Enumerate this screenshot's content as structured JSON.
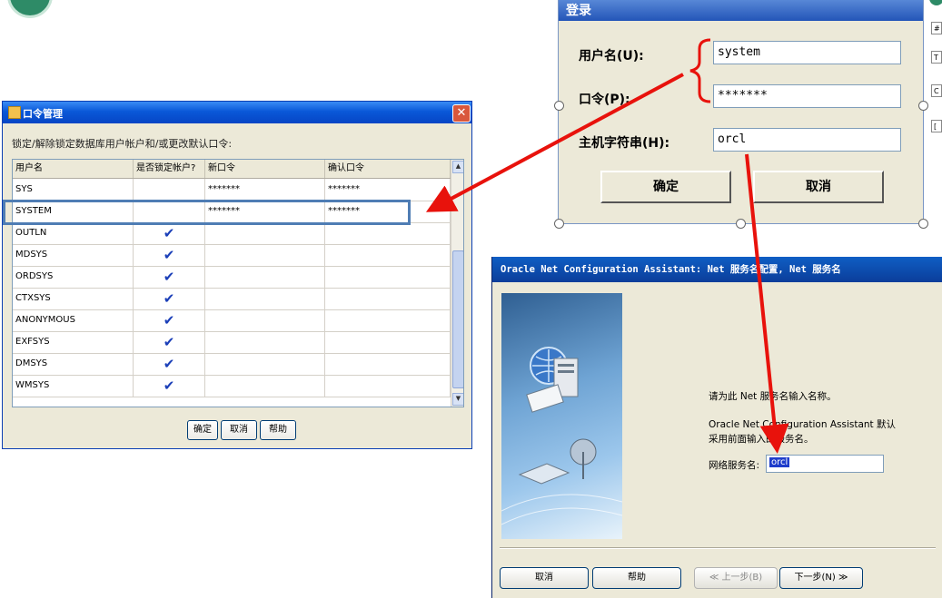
{
  "password_dialog": {
    "title": "口令管理",
    "close_glyph": "✕",
    "instruction": "锁定/解除锁定数据库用户帐户和/或更改默认口令:",
    "columns": [
      "用户名",
      "是否锁定帐户?",
      "新口令",
      "确认口令"
    ],
    "rows": [
      {
        "user": "SYS",
        "locked": false,
        "new_pwd": "*******",
        "confirm_pwd": "*******"
      },
      {
        "user": "SYSTEM",
        "locked": false,
        "new_pwd": "*******",
        "confirm_pwd": "*******"
      },
      {
        "user": "OUTLN",
        "locked": true,
        "new_pwd": "",
        "confirm_pwd": ""
      },
      {
        "user": "MDSYS",
        "locked": true,
        "new_pwd": "",
        "confirm_pwd": ""
      },
      {
        "user": "ORDSYS",
        "locked": true,
        "new_pwd": "",
        "confirm_pwd": ""
      },
      {
        "user": "CTXSYS",
        "locked": true,
        "new_pwd": "",
        "confirm_pwd": ""
      },
      {
        "user": "ANONYMOUS",
        "locked": true,
        "new_pwd": "",
        "confirm_pwd": ""
      },
      {
        "user": "EXFSYS",
        "locked": true,
        "new_pwd": "",
        "confirm_pwd": ""
      },
      {
        "user": "DMSYS",
        "locked": true,
        "new_pwd": "",
        "confirm_pwd": ""
      },
      {
        "user": "WMSYS",
        "locked": true,
        "new_pwd": "",
        "confirm_pwd": ""
      }
    ],
    "check_glyph": "✔",
    "buttons": {
      "ok": "确定",
      "cancel": "取消",
      "help": "帮助"
    }
  },
  "login_dialog": {
    "title": "登录",
    "username_label": "用户名(U):",
    "username_value": "system",
    "password_label": "口令(P):",
    "password_value": "*******",
    "host_label": "主机字符串(H):",
    "host_value": "orcl",
    "ok_button": "确定",
    "cancel_button": "取消"
  },
  "right_fragment": {
    "items": [
      "#",
      "T",
      "C",
      "["
    ]
  },
  "net_assistant": {
    "title": "Oracle Net Configuration Assistant: Net 服务名配置, Net 服务名",
    "prompt": "请为此 Net 服务名输入名称。",
    "default_text_line1": "Oracle Net Configuration Assistant 默认",
    "default_text_line2": "采用前面输入的服务名。",
    "service_label": "网络服务名:",
    "service_value": "orcl",
    "buttons": {
      "cancel": "取消",
      "help": "帮助",
      "back": "上一步(B)",
      "next": "下一步(N)"
    },
    "back_glyph": "≪",
    "next_glyph": "≫"
  },
  "colors": {
    "arrow": "#e8120c",
    "highlight": "#4f7db4",
    "titlebar": "#0a58d8",
    "check": "#1b3fb8"
  }
}
